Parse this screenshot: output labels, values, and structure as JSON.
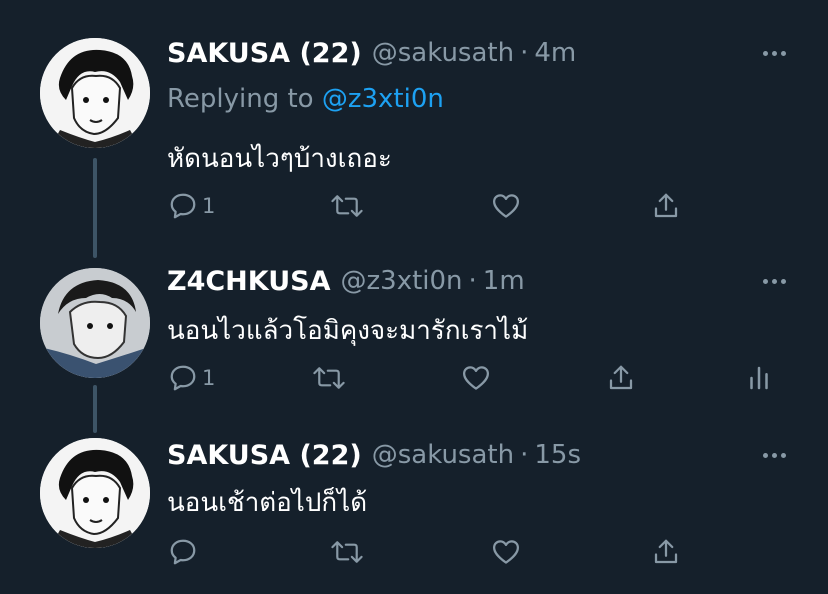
{
  "tweets": [
    {
      "name": "SAKUSA (22)",
      "handle": "@sakusath",
      "time": "4m",
      "replying_label": "Replying to",
      "replying_handle": "@z3xti0n",
      "text": "หัดนอนไวๆบ้างเถอะ",
      "reply_count": "1",
      "avatar": "sakusa-avatar"
    },
    {
      "name": "Z4CHKUSA",
      "handle": "@z3xti0n",
      "time": "1m",
      "text": "นอนไวแล้วโอมิคุงจะมารักเราไม้",
      "reply_count": "1",
      "avatar": "z4chkusa-avatar"
    },
    {
      "name": "SAKUSA (22)",
      "handle": "@sakusath",
      "time": "15s",
      "text": "นอนเช้าต่อไปก็ได้",
      "reply_count": "",
      "avatar": "sakusa-avatar"
    }
  ],
  "separator": "·",
  "icons": [
    "more-icon",
    "reply-icon",
    "retweet-icon",
    "like-icon",
    "share-icon",
    "analytics-icon"
  ],
  "colors": {
    "background": "#15202b",
    "muted": "#8899a6",
    "link": "#1da1f2",
    "text": "#ffffff"
  }
}
